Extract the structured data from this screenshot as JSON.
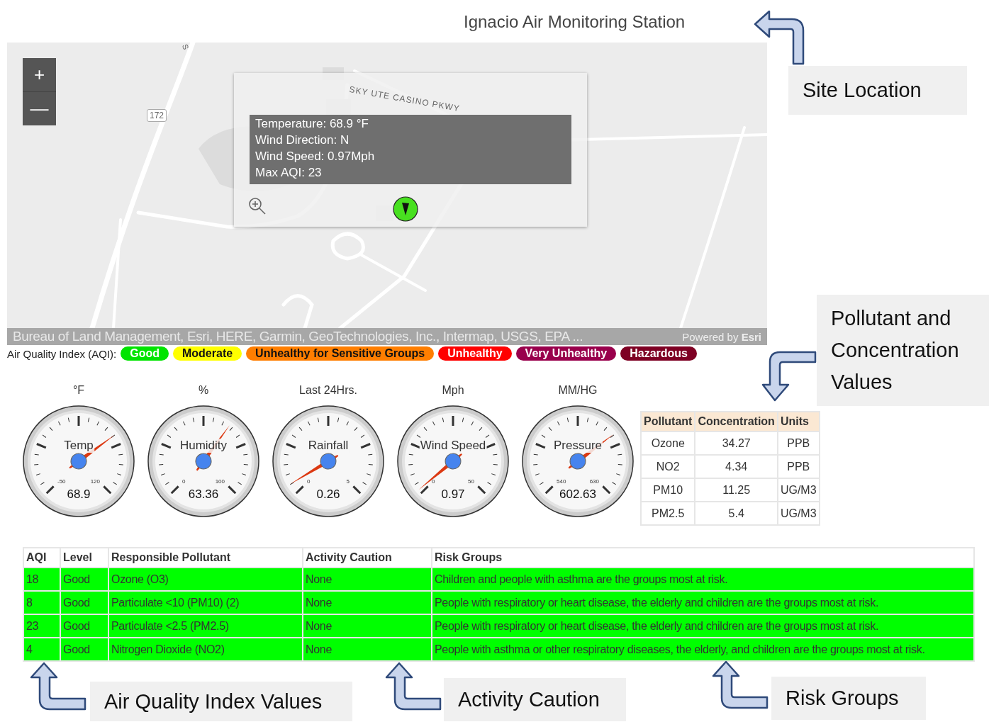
{
  "title": "Ignacio Air Monitoring Station",
  "map": {
    "road_label": "SKY UTE CASINO PKWY",
    "route_shield": "172",
    "road_edge_label": "S",
    "zoom_in": "+",
    "zoom_out": "—",
    "popup": {
      "lines": [
        "Temperature: 68.9 °F",
        "Wind Direction: N",
        "Wind Speed: 0.97Mph",
        "Max AQI: 23"
      ]
    },
    "attribution": "Bureau of Land Management, Esri, HERE, Garmin, GeoTechnologies, Inc., Intermap, USGS, EPA ...",
    "powered_by": "Powered by **Esri**"
  },
  "aqi_legend": {
    "label": "Air Quality Index (AQI):",
    "levels": [
      {
        "label": "Good",
        "color": "#00e400"
      },
      {
        "label": "Moderate",
        "color": "#ffff00"
      },
      {
        "label": "Unhealthy for Sensitive Groups",
        "color": "#ff7e00"
      },
      {
        "label": "Unhealthy",
        "color": "#ff0000"
      },
      {
        "label": "Very Unhealthy",
        "color": "#99004c"
      },
      {
        "label": "Hazardous",
        "color": "#7e0023"
      }
    ]
  },
  "gauges": [
    {
      "unit": "°F",
      "name": "Temp",
      "min": "-50",
      "max": "120",
      "value": "68.9"
    },
    {
      "unit": "%",
      "name": "Humidity",
      "min": "0",
      "max": "100",
      "value": "63.36"
    },
    {
      "unit": "Last 24Hrs.",
      "name": "Rainfall",
      "min": "0",
      "max": "5",
      "value": "0.26"
    },
    {
      "unit": "Mph",
      "name": "Wind Speed",
      "min": "0",
      "max": "50",
      "value": "0.97"
    },
    {
      "unit": "MM/HG",
      "name": "Pressure",
      "min": "540",
      "max": "630",
      "value": "602.63"
    }
  ],
  "pollutant_table": {
    "columns": [
      "Pollutant",
      "Concentration",
      "Units"
    ],
    "rows": [
      [
        "Ozone",
        "34.27",
        "PPB"
      ],
      [
        "NO2",
        "4.34",
        "PPB"
      ],
      [
        "PM10",
        "11.25",
        "UG/M3"
      ],
      [
        "PM2.5",
        "5.4",
        "UG/M3"
      ]
    ]
  },
  "aqi_table": {
    "columns": [
      "AQI",
      "Level",
      "Responsible Pollutant",
      "Activity Caution",
      "Risk Groups"
    ],
    "rows": [
      {
        "color": "#00ff00",
        "cells": [
          "18",
          "Good",
          "Ozone (O3)",
          "None",
          "Children and people with asthma are the groups most at risk."
        ]
      },
      {
        "color": "#00ff00",
        "cells": [
          "8",
          "Good",
          "Particulate <10 (PM10) (2)",
          "None",
          "People with respiratory or heart disease, the elderly and children are the groups most at risk."
        ]
      },
      {
        "color": "#00ff00",
        "cells": [
          "23",
          "Good",
          "Particulate <2.5 (PM2.5)",
          "None",
          "People with respiratory or heart disease, the elderly and children are the groups most at risk."
        ]
      },
      {
        "color": "#00ff00",
        "cells": [
          "4",
          "Good",
          "Nitrogen Dioxide (NO2)",
          "None",
          "People with asthma or other respiratory diseases, the elderly, and children are the groups most at risk."
        ]
      }
    ]
  },
  "callouts": [
    {
      "kind": "left",
      "text": "Site Location"
    },
    {
      "kind": "down",
      "text": "Pollutant and Concentration Values"
    },
    {
      "kind": "up",
      "text": "Air Quality Index Values"
    },
    {
      "kind": "up",
      "text": "Activity Caution"
    },
    {
      "kind": "up",
      "text": "Risk Groups"
    }
  ]
}
